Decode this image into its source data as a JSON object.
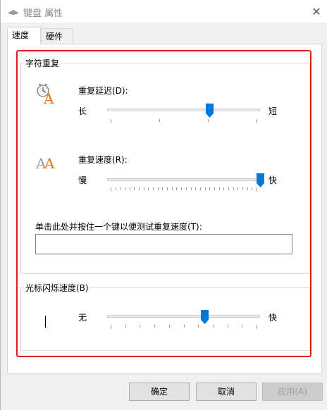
{
  "window": {
    "title": "键盘 属性",
    "close_glyph": "✕"
  },
  "tabs": [
    {
      "label": "速度",
      "active": true
    },
    {
      "label": "硬件",
      "active": false
    }
  ],
  "char_repeat": {
    "group_title": "字符重复",
    "delay": {
      "label": "重复延迟(D):",
      "min_label": "长",
      "max_label": "短",
      "value_fraction": 0.67,
      "tick_count": 4
    },
    "rate": {
      "label": "重复速度(R):",
      "min_label": "慢",
      "max_label": "快",
      "value_fraction": 1.0,
      "tick_count": 32
    },
    "test": {
      "label": "单击此处并按住一个键以便测试重复速度(T):",
      "value": ""
    }
  },
  "cursor_blink": {
    "group_title": "光标闪烁速度(B)",
    "min_label": "无",
    "max_label": "快",
    "value_fraction": 0.64,
    "tick_count": 11
  },
  "buttons": {
    "ok": "确定",
    "cancel": "取消",
    "apply": "应用(A)"
  },
  "icons": {
    "title": "keyboard-icon",
    "delay": "clock-letter-a-icon",
    "rate": "double-letter-a-icon",
    "close": "close-icon"
  },
  "colors": {
    "accent": "#0078d7",
    "highlight_frame": "#e0201b",
    "letter_orange": "#e8731a"
  }
}
